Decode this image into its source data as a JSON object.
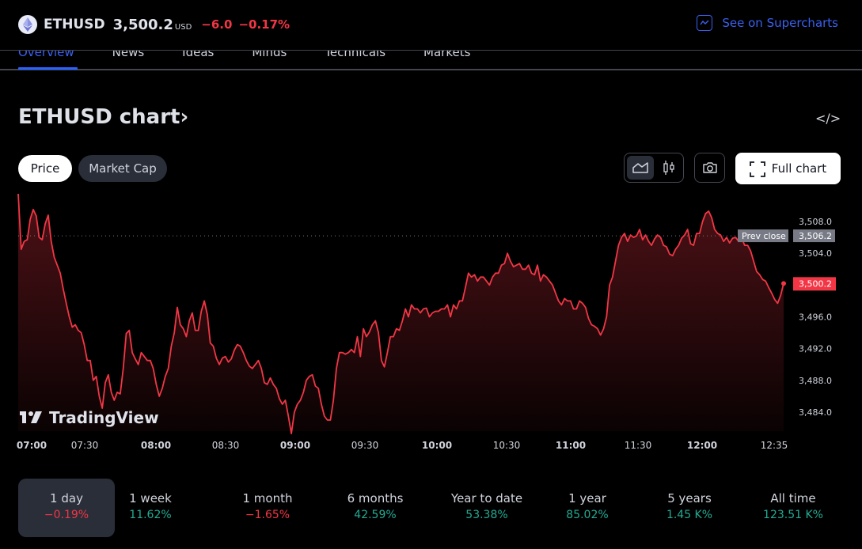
{
  "header": {
    "symbol": "ETHUSD",
    "price": "3,500.2",
    "currency": "USD",
    "change": "−6.0",
    "change_pct": "−0.17%",
    "supercharts_link": "See on Supercharts",
    "icons": {
      "coin": "ethereum-icon",
      "supercharts": "chart-line-icon"
    }
  },
  "tabs": [
    {
      "label": "Overview",
      "active": true
    },
    {
      "label": "News"
    },
    {
      "label": "Ideas"
    },
    {
      "label": "Minds"
    },
    {
      "label": "Technicals"
    },
    {
      "label": "Markets"
    }
  ],
  "section": {
    "title": "ETHUSD chart",
    "chevron": "›",
    "embed_icon": "</>",
    "pills": [
      {
        "label": "Price",
        "active": true
      },
      {
        "label": "Market Cap"
      }
    ],
    "full_chart": "Full chart"
  },
  "colors": {
    "down": "#f23645",
    "up": "#22ab94",
    "accent": "#2962ff",
    "line": "#f23645"
  },
  "chart_data": {
    "type": "area",
    "title": "ETHUSD",
    "xlabel": "",
    "ylabel": "",
    "x_ticks": [
      {
        "label": "07:00",
        "bold": true,
        "t": 0
      },
      {
        "label": "07:30",
        "bold": false,
        "t": 30
      },
      {
        "label": "08:00",
        "bold": true,
        "t": 60
      },
      {
        "label": "08:30",
        "bold": false,
        "t": 90
      },
      {
        "label": "09:00",
        "bold": true,
        "t": 120
      },
      {
        "label": "09:30",
        "bold": false,
        "t": 150
      },
      {
        "label": "10:00",
        "bold": true,
        "t": 180
      },
      {
        "label": "10:30",
        "bold": false,
        "t": 210
      },
      {
        "label": "11:00",
        "bold": true,
        "t": 240
      },
      {
        "label": "11:30",
        "bold": false,
        "t": 270
      },
      {
        "label": "12:00",
        "bold": true,
        "t": 300
      },
      {
        "label": "12:35",
        "bold": false,
        "t": 335
      }
    ],
    "y_ticks": [
      "3,508.0",
      "3,504.0",
      "3,496.0",
      "3,492.0",
      "3,488.0",
      "3,484.0"
    ],
    "y_tick_values": [
      3508,
      3504,
      3496,
      3492,
      3488,
      3484
    ],
    "ylim": [
      3481.0,
      3510.0
    ],
    "prev_close": {
      "label": "Prev close",
      "value": 3506.2,
      "text": "3,506.2"
    },
    "last": {
      "value": 3500.2,
      "text": "3,500.2"
    },
    "watermark": "TradingView",
    "grid": false,
    "values": [
      3511.5,
      3504.5,
      3505.5,
      3505.7,
      3508.3,
      3509.5,
      3508.7,
      3506.0,
      3505.7,
      3507.7,
      3508.8,
      3505.5,
      3503.5,
      3502.5,
      3501.5,
      3499.5,
      3497.7,
      3496.0,
      3494.7,
      3495.0,
      3494.3,
      3494.0,
      3492.5,
      3490.5,
      3490.5,
      3488.0,
      3488.5,
      3486.0,
      3484.5,
      3487.7,
      3488.7,
      3486.5,
      3485.5,
      3486.5,
      3486.3,
      3489.5,
      3493.9,
      3494.3,
      3491.5,
      3490.7,
      3490.0,
      3491.5,
      3491.0,
      3490.5,
      3490.5,
      3489.5,
      3487.5,
      3486.0,
      3487.0,
      3488.5,
      3489.5,
      3492.3,
      3494.0,
      3497.2,
      3495.0,
      3494.5,
      3493.5,
      3495.5,
      3496.5,
      3494.3,
      3494.3,
      3496.7,
      3498.0,
      3496.3,
      3492.7,
      3492.3,
      3490.8,
      3490.0,
      3490.8,
      3491.0,
      3490.3,
      3490.7,
      3491.8,
      3492.5,
      3492.3,
      3491.5,
      3490.5,
      3489.8,
      3489.5,
      3490.0,
      3490.5,
      3489.5,
      3487.7,
      3487.5,
      3488.3,
      3487.5,
      3487.0,
      3485.7,
      3485.0,
      3485.5,
      3483.5,
      3481.3,
      3484.0,
      3485.0,
      3485.5,
      3486.5,
      3488.0,
      3488.5,
      3488.7,
      3487.3,
      3487.0,
      3485.0,
      3483.5,
      3483.0,
      3483.0,
      3485.5,
      3489.5,
      3491.5,
      3491.5,
      3491.3,
      3491.5,
      3491.9,
      3491.5,
      3493.5,
      3491.0,
      3494.5,
      3493.5,
      3494.1,
      3495.0,
      3495.5,
      3494.0,
      3490.5,
      3489.7,
      3491.5,
      3493.5,
      3493.5,
      3494.5,
      3494.3,
      3495.5,
      3497.0,
      3496.0,
      3497.5,
      3497.0,
      3497.0,
      3496.5,
      3497.0,
      3497.1,
      3496.0,
      3496.5,
      3496.7,
      3496.7,
      3497.0,
      3497.0,
      3497.5,
      3496.0,
      3497.5,
      3497.0,
      3498.0,
      3498.0,
      3499.7,
      3501.5,
      3501.0,
      3501.3,
      3500.5,
      3501.0,
      3501.0,
      3500.5,
      3500.0,
      3501.0,
      3501.5,
      3501.5,
      3502.5,
      3502.7,
      3504.0,
      3503.0,
      3502.3,
      3502.5,
      3502.7,
      3502.0,
      3502.0,
      3502.5,
      3501.5,
      3501.3,
      3502.5,
      3500.5,
      3501.3,
      3501.0,
      3500.5,
      3500.0,
      3499.0,
      3498.0,
      3497.5,
      3498.3,
      3498.0,
      3498.0,
      3497.0,
      3497.0,
      3498.0,
      3497.7,
      3497.2,
      3495.8,
      3495.0,
      3494.8,
      3494.5,
      3493.7,
      3494.5,
      3496.0,
      3500.0,
      3501.0,
      3503.0,
      3505.0,
      3506.0,
      3506.5,
      3505.5,
      3506.3,
      3506.0,
      3506.2,
      3507.0,
      3505.7,
      3506.3,
      3505.5,
      3505.0,
      3505.8,
      3506.3,
      3506.0,
      3505.0,
      3504.8,
      3503.9,
      3503.7,
      3504.5,
      3505.0,
      3505.9,
      3506.3,
      3507.0,
      3505.2,
      3505.0,
      3506.5,
      3506.5,
      3508.0,
      3509.0,
      3509.3,
      3508.5,
      3507.0,
      3506.5,
      3506.3,
      3505.5,
      3506.0,
      3505.3,
      3505.9,
      3506.0,
      3505.5,
      3506.0,
      3505.0,
      3505.0,
      3504.3,
      3503.0,
      3501.7,
      3501.3,
      3500.7,
      3500.5,
      3499.7,
      3499.0,
      3498.2,
      3497.7,
      3498.7,
      3500.2
    ]
  },
  "periods": [
    {
      "label": "1 day",
      "value": "−0.19%",
      "dir": "neg",
      "active": true
    },
    {
      "label": "1 week",
      "value": "11.62%",
      "dir": "pos"
    },
    {
      "label": "1 month",
      "value": "−1.65%",
      "dir": "neg"
    },
    {
      "label": "6 months",
      "value": "42.59%",
      "dir": "pos"
    },
    {
      "label": "Year to date",
      "value": "53.38%",
      "dir": "pos"
    },
    {
      "label": "1 year",
      "value": "85.02%",
      "dir": "pos"
    },
    {
      "label": "5 years",
      "value": "1.45 K%",
      "dir": "pos"
    },
    {
      "label": "All time",
      "value": "123.51 K%",
      "dir": "pos"
    }
  ]
}
